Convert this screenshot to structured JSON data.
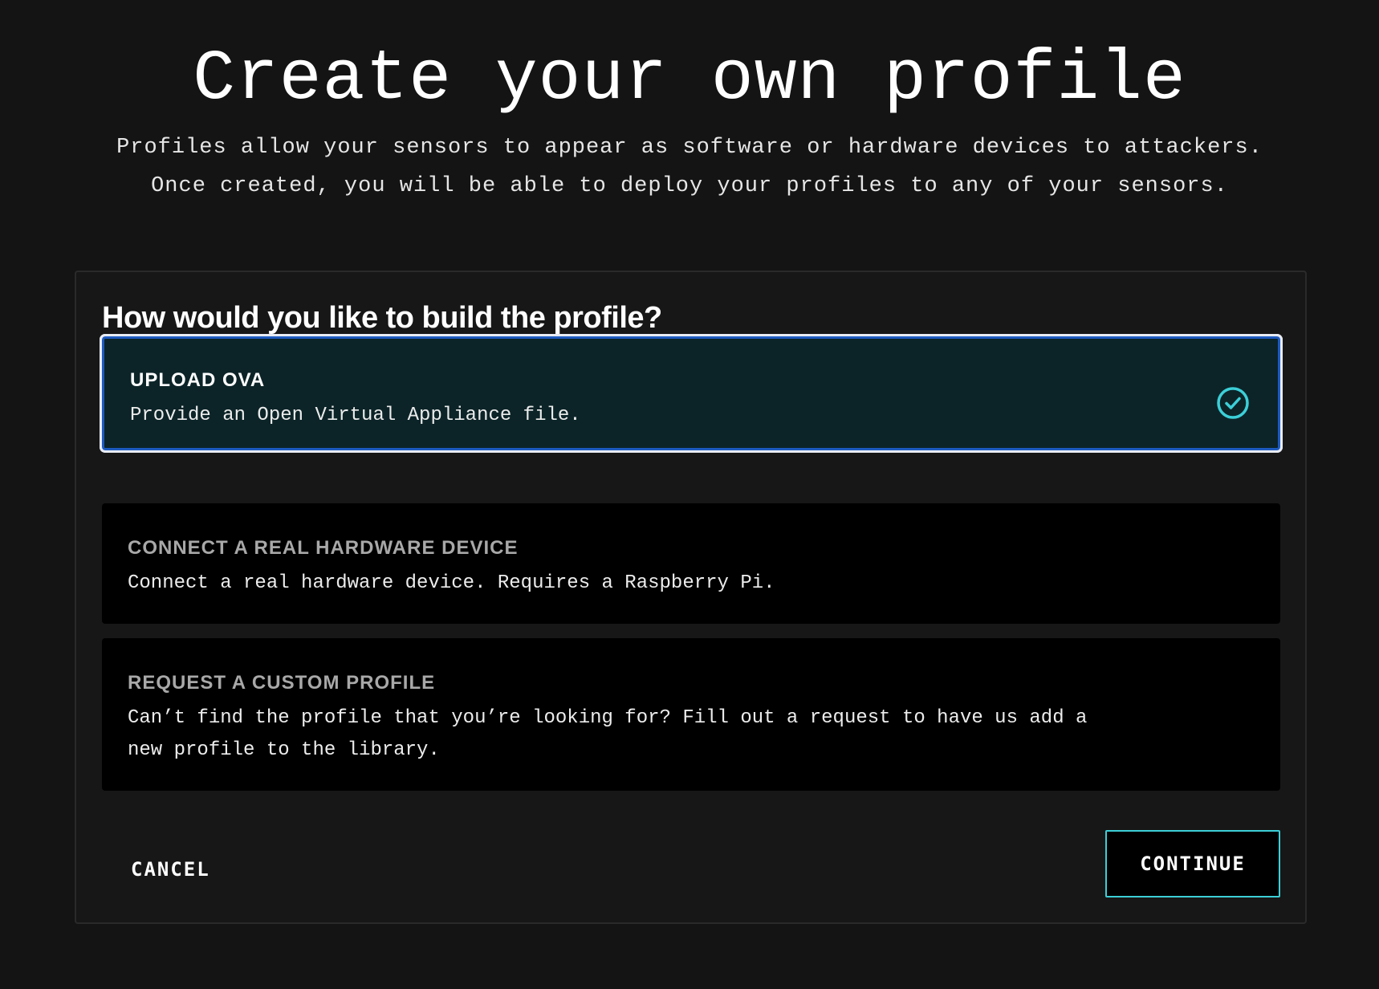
{
  "header": {
    "title": "Create your own profile",
    "subtitle": "Profiles allow your sensors to appear as software or hardware devices to attackers. Once created, you will be able to deploy your profiles to any of your sensors."
  },
  "card": {
    "question": "How would you like to build the profile?",
    "options": [
      {
        "title": "UPLOAD OVA",
        "description": "Provide an Open Virtual Appliance file.",
        "selected": true,
        "icon": "check-circle-icon"
      },
      {
        "title": "CONNECT A REAL HARDWARE DEVICE",
        "description": "Connect a real hardware device. Requires a Raspberry Pi.",
        "selected": false
      },
      {
        "title": "REQUEST A CUSTOM PROFILE",
        "description": "Can’t find the profile that you’re looking for? Fill out a request to have us add a new profile to the library.",
        "selected": false
      }
    ],
    "cancel_label": "CANCEL",
    "continue_label": "CONTINUE"
  },
  "colors": {
    "background": "#141414",
    "card": "#171717",
    "selected_bg": "#0c2428",
    "selected_border": "#1d5ac0",
    "accent": "#3ccfd8"
  }
}
